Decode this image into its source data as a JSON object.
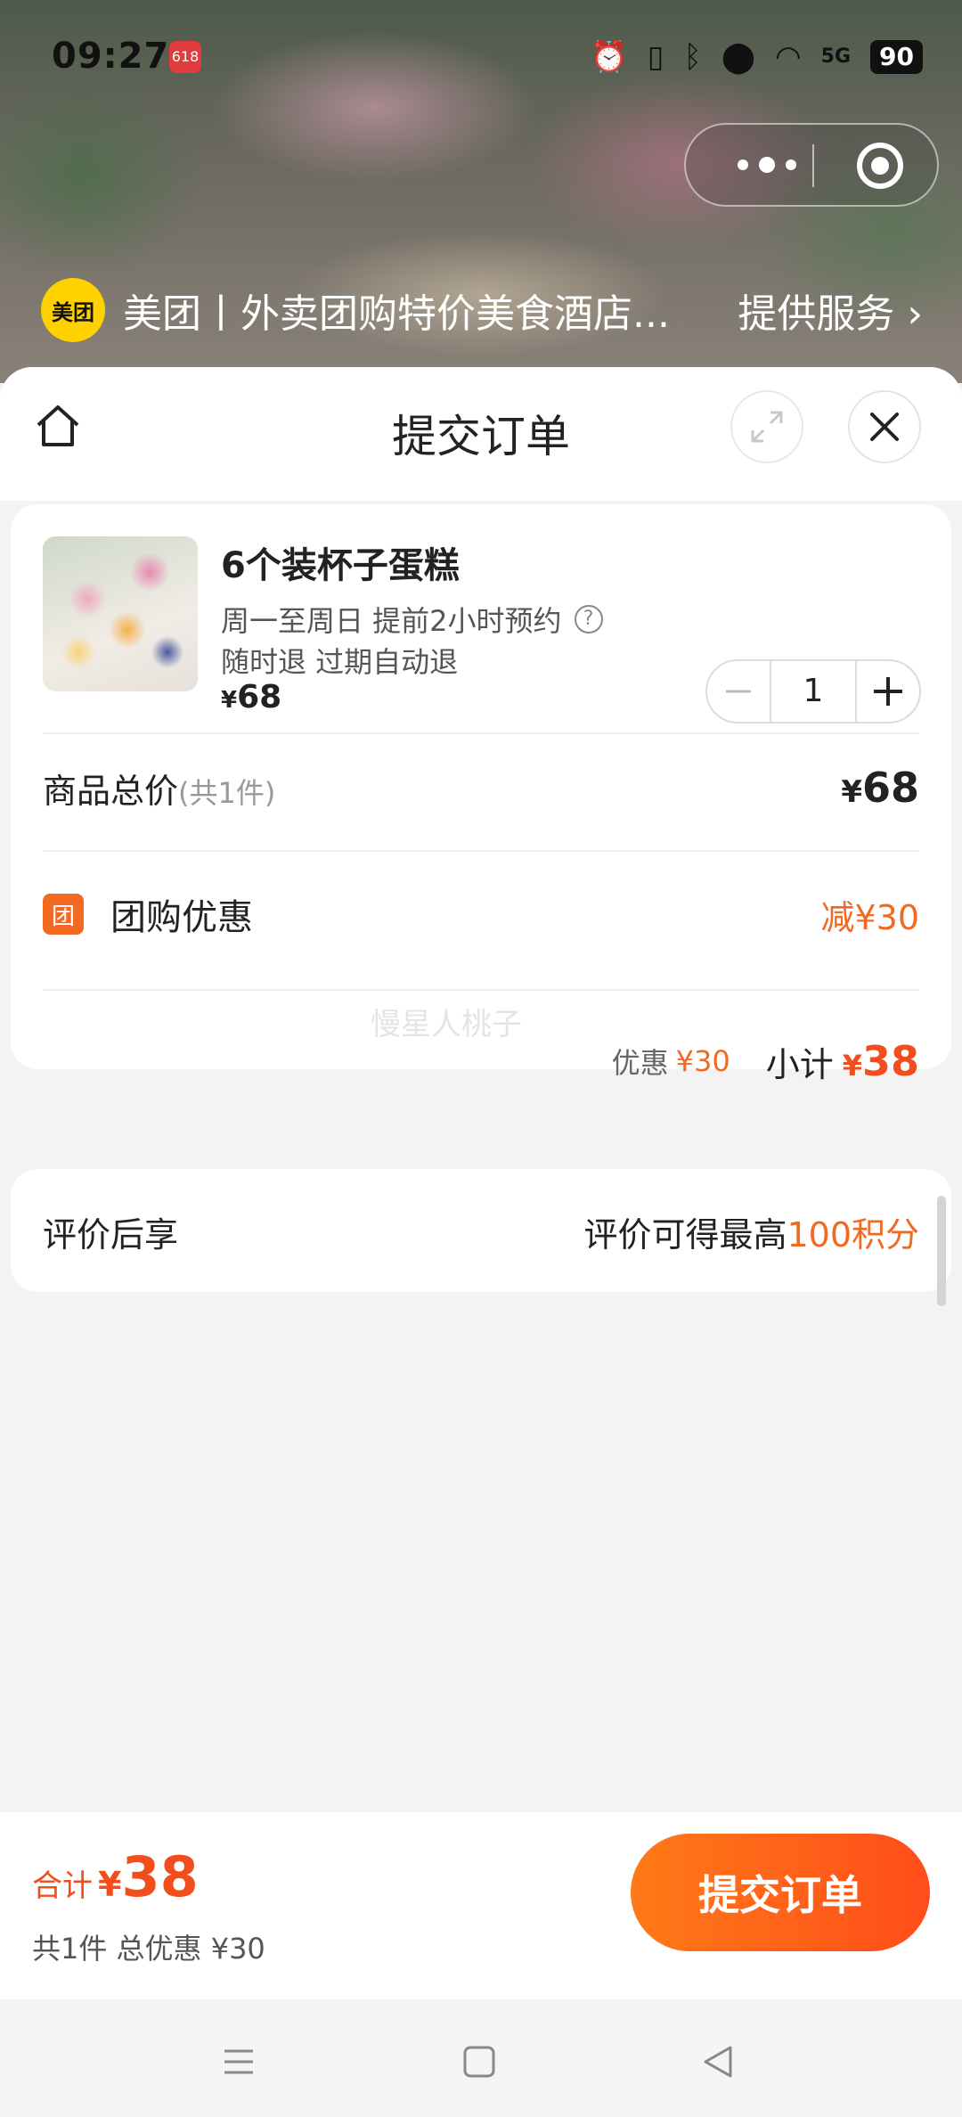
{
  "status_bar": {
    "time": "09:27",
    "app_badge": "618",
    "network": "5G",
    "battery": "90"
  },
  "capsule": {
    "more_icon": "more-dots-icon",
    "close_icon": "target-icon"
  },
  "merchant": {
    "logo_text": "美团",
    "name": "美团丨外卖团购特价美食酒店...",
    "service_label": "提供服务"
  },
  "sheet": {
    "title": "提交订单",
    "home_icon": "home-icon",
    "expand_icon": "expand-icon",
    "close_icon": "close-icon"
  },
  "product": {
    "title": "6个装杯子蛋糕",
    "availability": "周一至周日 提前2小时预约",
    "help_icon": "?",
    "refund_policy": "随时退 过期自动退",
    "price_symbol": "¥",
    "price": "68",
    "quantity": "1"
  },
  "summary": {
    "total_label": "商品总价",
    "total_count": "(共1件)",
    "total_symbol": "¥",
    "total_amount": "68",
    "discount_icon_text": "团",
    "discount_label": "团购优惠",
    "discount_amount": "减¥30",
    "watermark": "慢星人桃子",
    "sub_discount_label": "优惠",
    "sub_discount_value": "¥30",
    "subtotal_label": "小计",
    "subtotal_symbol": "¥",
    "subtotal_amount": "38"
  },
  "review": {
    "label": "评价后享",
    "text": "评价可得最高",
    "points": "100积分"
  },
  "bottom_bar": {
    "total_label": "合计",
    "total_symbol": "¥",
    "total_amount": "38",
    "sub_text": "共1件 总优惠 ¥30",
    "submit_label": "提交订单"
  },
  "colors": {
    "accent": "#f24d1d",
    "discount": "#f26a22",
    "meituan_yellow": "#ffd100"
  }
}
